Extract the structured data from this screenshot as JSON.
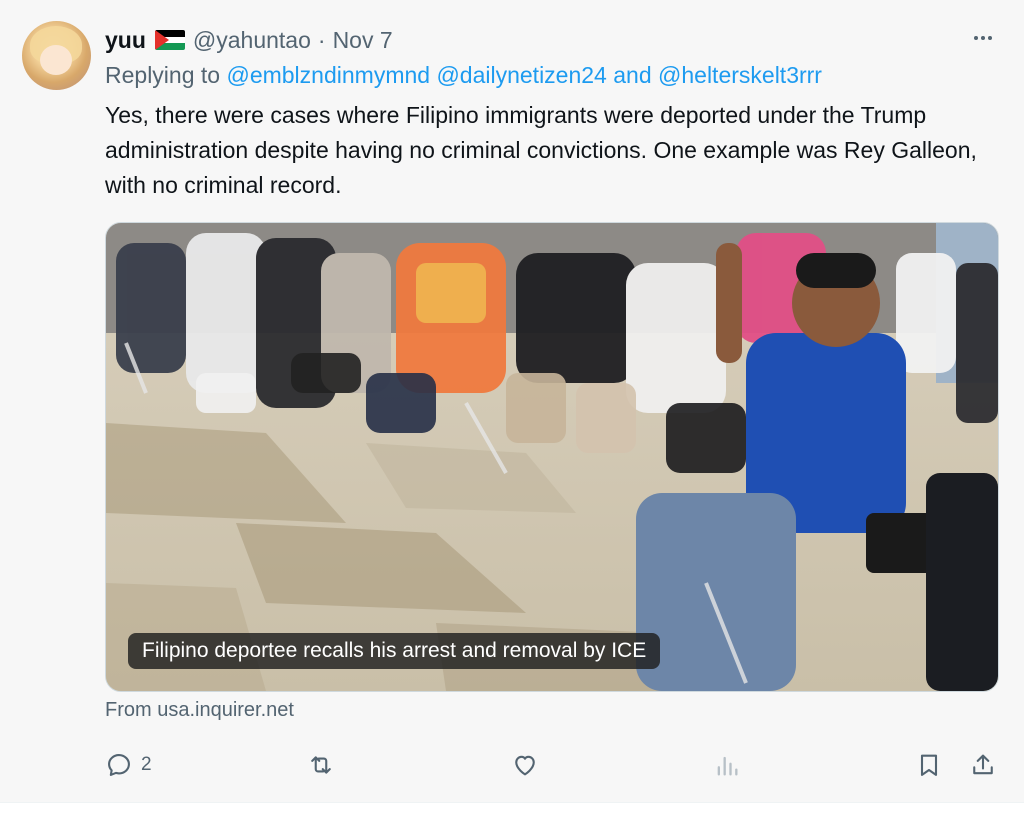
{
  "tweet": {
    "display_name": "yuu",
    "handle": "@yahuntao",
    "separator": "·",
    "date": "Nov 7",
    "replying_prefix": "Replying to",
    "replying_to": [
      "@emblzndinmymnd",
      "@dailynetizen24",
      "@helterskelt3rrr"
    ],
    "replying_joiner": "and",
    "text": "Yes, there were cases where Filipino immigrants were deported under the Trump administration despite having no criminal convictions. One example was Rey Galleon, with no criminal record.",
    "media_caption": "Filipino deportee recalls his arrest and removal by ICE",
    "link_source": "From usa.inquirer.net",
    "reply_count": "2",
    "flag_icon": "palestine-flag-icon"
  },
  "colors": {
    "link": "#1d9bf0",
    "secondary_text": "#536471",
    "primary_text": "#0f1419"
  }
}
